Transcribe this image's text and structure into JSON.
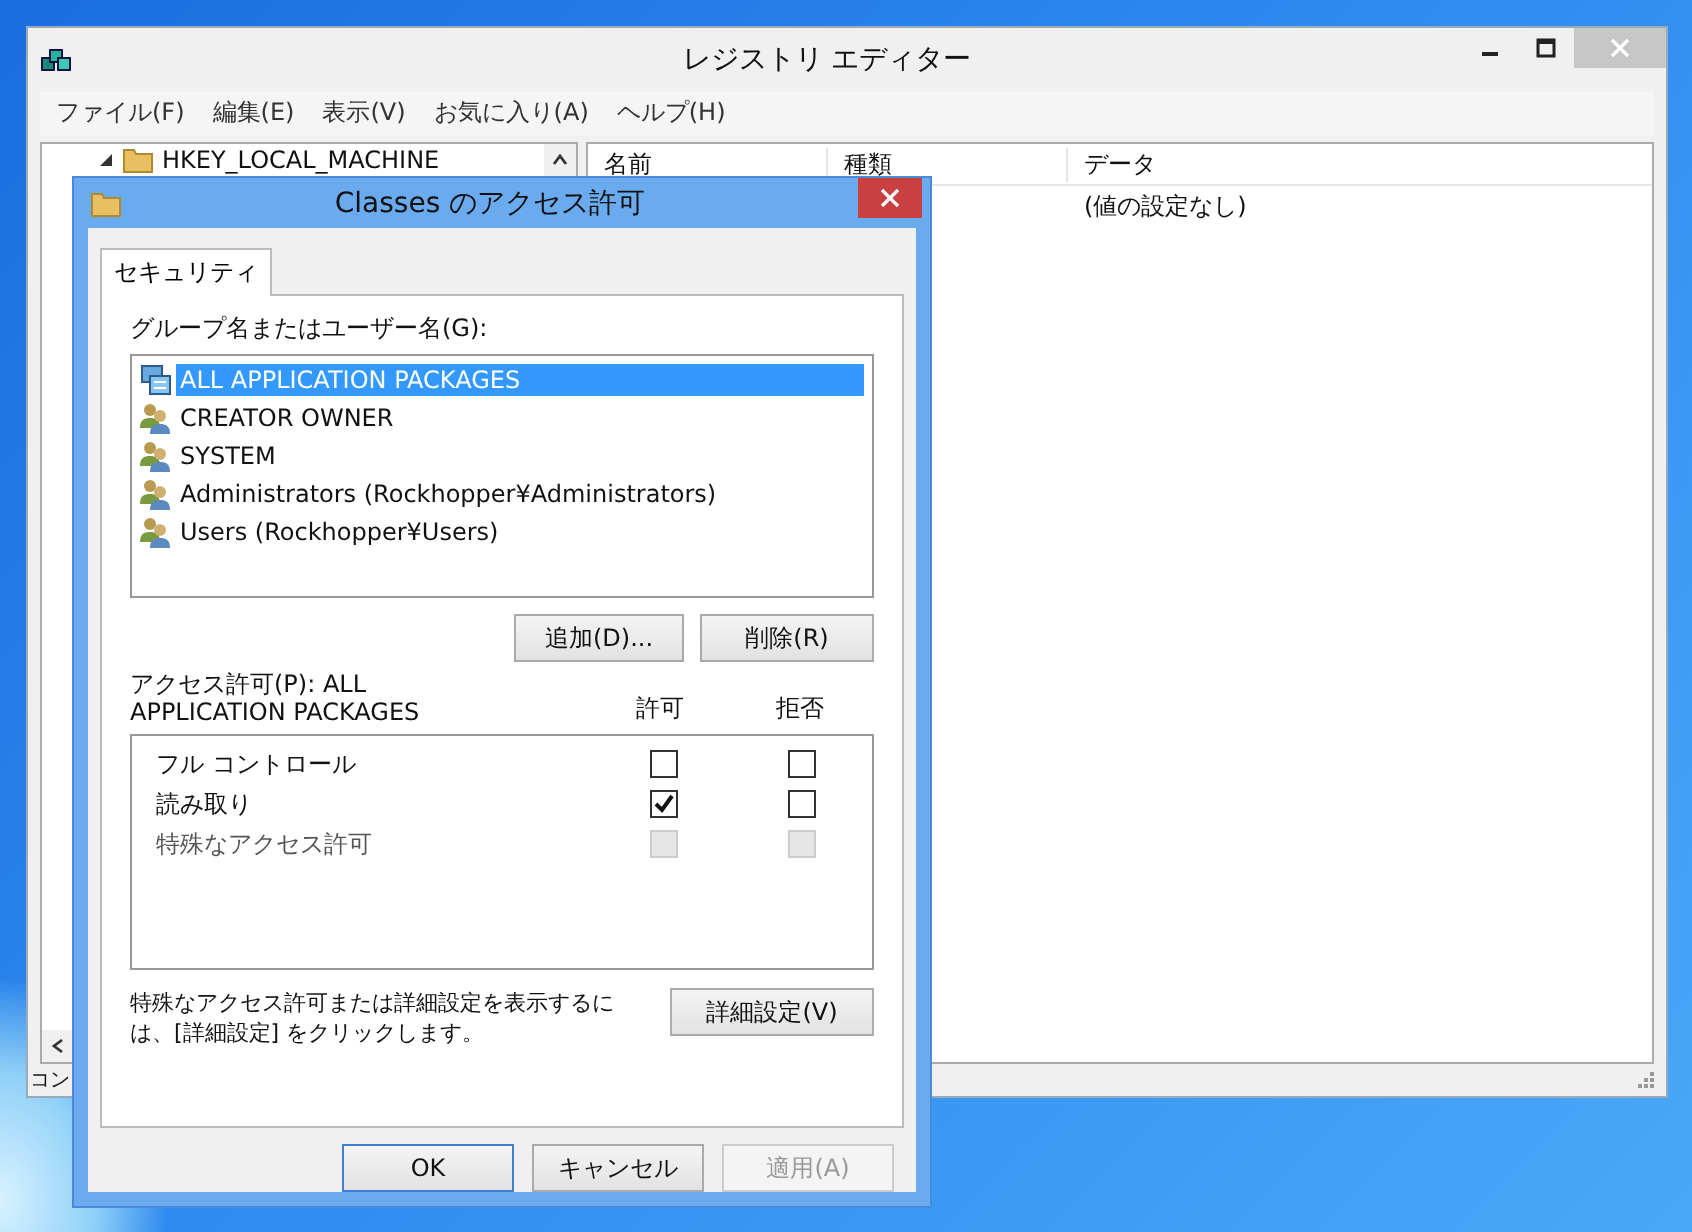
{
  "main_window": {
    "title": "レジストリ エディター",
    "menu": [
      "ファイル(F)",
      "編集(E)",
      "表示(V)",
      "お気に入り(A)",
      "ヘルプ(H)"
    ],
    "tree": {
      "items": [
        {
          "label": "HKEY_LOCAL_MACHINE",
          "expanded": true
        }
      ]
    },
    "list": {
      "columns": [
        "名前",
        "種類",
        "データ"
      ],
      "rows": [
        {
          "data": "(値の設定なし)"
        }
      ]
    },
    "status_bar": "コン"
  },
  "dialog": {
    "title": "Classes のアクセス許可",
    "tabs": [
      {
        "label": "セキュリティ",
        "selected": true
      }
    ],
    "principals_label": "グループ名またはユーザー名(G):",
    "principals": [
      {
        "name": "ALL APPLICATION PACKAGES",
        "kind": "package",
        "selected": true
      },
      {
        "name": "CREATOR OWNER",
        "kind": "group",
        "selected": false
      },
      {
        "name": "SYSTEM",
        "kind": "group",
        "selected": false
      },
      {
        "name": "Administrators (Rockhopper¥Administrators)",
        "kind": "group",
        "selected": false
      },
      {
        "name": "Users (Rockhopper¥Users)",
        "kind": "group",
        "selected": false
      }
    ],
    "add_button": "追加(D)...",
    "remove_button": "削除(R)",
    "permissions_label": [
      "アクセス許可(P): ALL",
      "APPLICATION PACKAGES"
    ],
    "allow_header": "許可",
    "deny_header": "拒否",
    "permissions": [
      {
        "name": "フル コントロール",
        "allow": false,
        "deny": false,
        "disabled": false
      },
      {
        "name": "読み取り",
        "allow": true,
        "deny": false,
        "disabled": false
      },
      {
        "name": "特殊なアクセス許可",
        "allow": false,
        "deny": false,
        "disabled": true
      }
    ],
    "advanced_note": [
      "特殊なアクセス許可または詳細設定を表示するに",
      "は、[詳細設定] をクリックします。"
    ],
    "advanced_button": "詳細設定(V)",
    "buttons": [
      {
        "label": "OK",
        "default": true,
        "disabled": false
      },
      {
        "label": "キャンセル",
        "default": false,
        "disabled": false
      },
      {
        "label": "適用(A)",
        "default": false,
        "disabled": true
      }
    ]
  }
}
